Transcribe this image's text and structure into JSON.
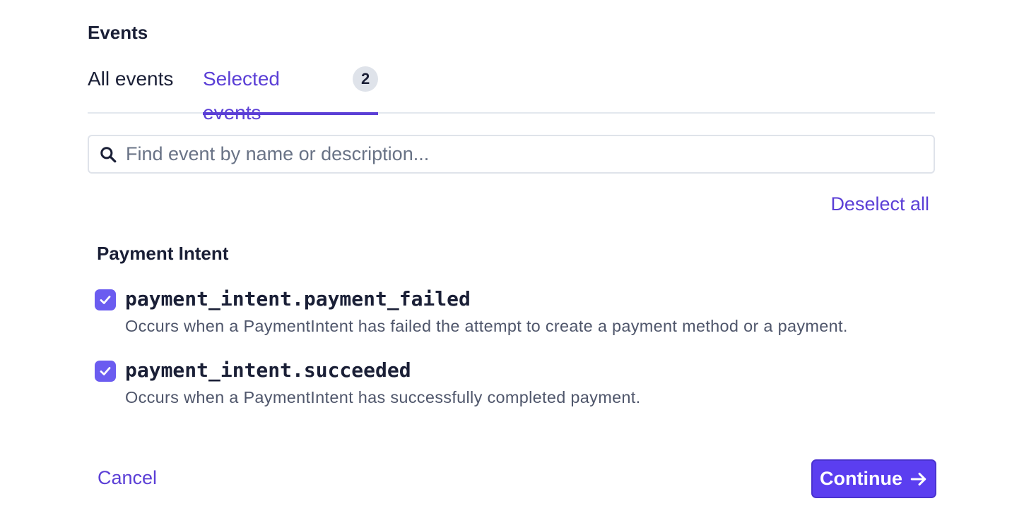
{
  "section": {
    "title": "Events"
  },
  "tabs": [
    {
      "label": "All events",
      "active": false
    },
    {
      "label": "Selected events",
      "active": true,
      "count": "2"
    }
  ],
  "search": {
    "placeholder": "Find event by name or description...",
    "value": "",
    "icon": "search-icon"
  },
  "actions": {
    "deselect_all": "Deselect all"
  },
  "group": {
    "title": "Payment Intent",
    "events": [
      {
        "name": "payment_intent.payment_failed",
        "description": "Occurs when a PaymentIntent has failed the attempt to create a payment method or a payment.",
        "checked": true
      },
      {
        "name": "payment_intent.succeeded",
        "description": "Occurs when a PaymentIntent has successfully completed payment.",
        "checked": true
      }
    ]
  },
  "footer": {
    "cancel_label": "Cancel",
    "continue_label": "Continue",
    "continue_icon": "arrow-right-icon"
  },
  "colors": {
    "accent": "#5b3fd6",
    "primary_button": "#5b3ef0",
    "checkbox": "#6b5cf0",
    "text": "#1a1f36",
    "muted": "#4f566b"
  }
}
